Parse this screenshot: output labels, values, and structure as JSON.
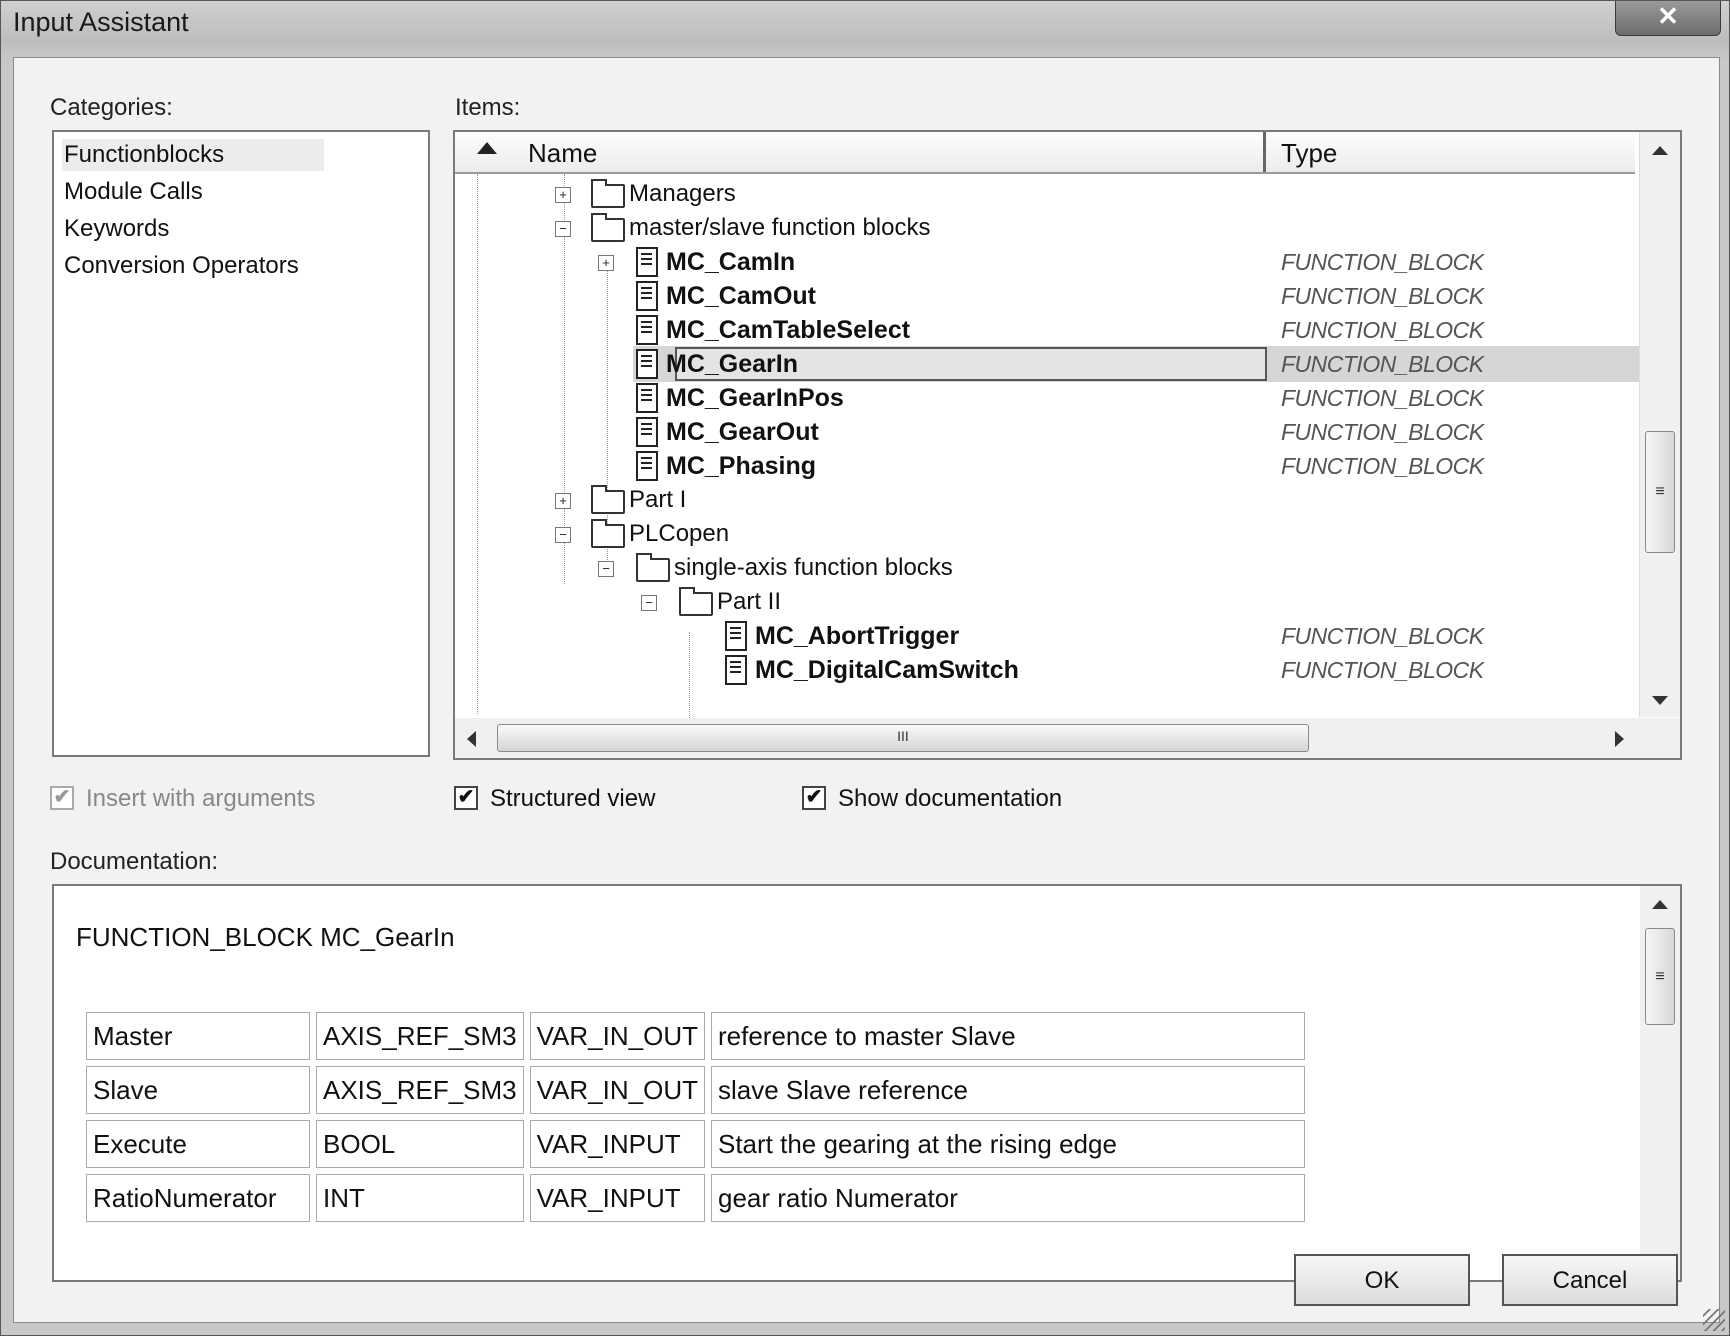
{
  "window": {
    "title": "Input Assistant",
    "close_glyph": "✕"
  },
  "labels": {
    "categories": "Categories:",
    "items": "Items:",
    "documentation": "Documentation:"
  },
  "categories": [
    "Functionblocks",
    "Module Calls",
    "Keywords",
    "Conversion Operators"
  ],
  "selected_category": "Functionblocks",
  "items_header": {
    "name": "Name",
    "type": "Type"
  },
  "tree": [
    {
      "label": "Managers",
      "kind": "folder",
      "expander": "+",
      "type": ""
    },
    {
      "label": "master/slave function blocks",
      "kind": "folder",
      "expander": "−",
      "type": ""
    },
    {
      "label": "MC_CamIn",
      "kind": "function-block",
      "expander": "+",
      "type": "FUNCTION_BLOCK"
    },
    {
      "label": "MC_CamOut",
      "kind": "function-block",
      "expander": "",
      "type": "FUNCTION_BLOCK"
    },
    {
      "label": "MC_CamTableSelect",
      "kind": "function-block",
      "expander": "",
      "type": "FUNCTION_BLOCK"
    },
    {
      "label": "MC_GearIn",
      "kind": "function-block",
      "expander": "",
      "type": "FUNCTION_BLOCK",
      "selected": true
    },
    {
      "label": "MC_GearInPos",
      "kind": "function-block",
      "expander": "",
      "type": "FUNCTION_BLOCK"
    },
    {
      "label": "MC_GearOut",
      "kind": "function-block",
      "expander": "",
      "type": "FUNCTION_BLOCK"
    },
    {
      "label": "MC_Phasing",
      "kind": "function-block",
      "expander": "",
      "type": "FUNCTION_BLOCK"
    },
    {
      "label": "Part I",
      "kind": "folder",
      "expander": "+",
      "type": ""
    },
    {
      "label": "PLCopen",
      "kind": "folder",
      "expander": "−",
      "type": ""
    },
    {
      "label": "single-axis function blocks",
      "kind": "folder",
      "expander": "−",
      "type": ""
    },
    {
      "label": "Part II",
      "kind": "folder",
      "expander": "−",
      "type": ""
    },
    {
      "label": "MC_AbortTrigger",
      "kind": "function-block",
      "expander": "",
      "type": "FUNCTION_BLOCK"
    },
    {
      "label": "MC_DigitalCamSwitch",
      "kind": "function-block",
      "expander": "",
      "type": "FUNCTION_BLOCK"
    }
  ],
  "options": {
    "insert_with_arguments": {
      "label": "Insert with arguments",
      "checked": true,
      "enabled": false
    },
    "structured_view": {
      "label": "Structured view",
      "checked": true,
      "enabled": true
    },
    "show_documentation": {
      "label": "Show documentation",
      "checked": true,
      "enabled": true
    }
  },
  "checkmark": "✔",
  "documentation": {
    "heading": "FUNCTION_BLOCK MC_GearIn",
    "rows": [
      [
        "Master",
        "AXIS_REF_SM3",
        "VAR_IN_OUT",
        "reference to master Slave"
      ],
      [
        "Slave",
        "AXIS_REF_SM3",
        "VAR_IN_OUT",
        "slave Slave reference"
      ],
      [
        "Execute",
        "BOOL",
        "VAR_INPUT",
        "Start the gearing at the rising edge"
      ],
      [
        "RatioNumerator",
        "INT",
        "VAR_INPUT",
        "gear ratio Numerator"
      ]
    ]
  },
  "scroll": {
    "grip_glyph": "≡",
    "h_grip_glyph": "III"
  },
  "buttons": {
    "ok": "OK",
    "cancel": "Cancel"
  }
}
